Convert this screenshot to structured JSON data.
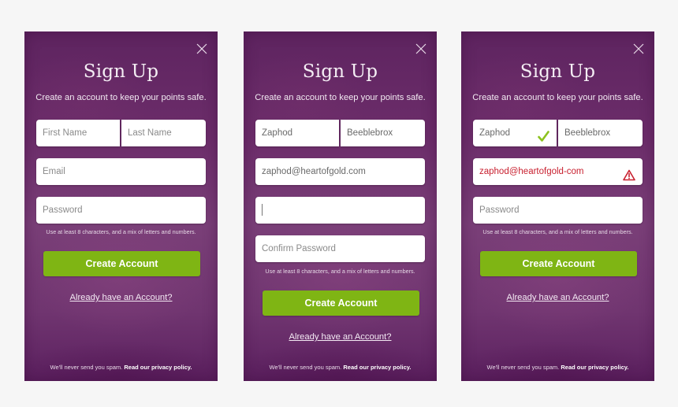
{
  "common": {
    "title": "Sign Up",
    "subtitle": "Create an account to keep your points safe.",
    "password_hint": "Use at least 8 characters, and a mix of letters and numbers.",
    "create_button": "Create Account",
    "login_link": "Already have an Account?",
    "footer_text": "We'll never send you spam.",
    "footer_link": "Read our privacy policy.",
    "icons": {
      "close": "close-icon",
      "check": "check-icon",
      "warning": "warning-icon"
    },
    "colors": {
      "panel": "#6c2d6a",
      "button": "#7fb514",
      "error": "#c8202f",
      "success": "#8cc21f",
      "page_bg": "#f6f6f6"
    }
  },
  "panels": [
    {
      "state": "empty",
      "first_name": {
        "value": "",
        "placeholder": "First Name"
      },
      "last_name": {
        "value": "",
        "placeholder": "Last Name"
      },
      "email": {
        "value": "",
        "placeholder": "Email"
      },
      "password": {
        "value": "",
        "placeholder": "Password"
      }
    },
    {
      "state": "filling",
      "first_name": {
        "value": "Zaphod",
        "placeholder": "First Name"
      },
      "last_name": {
        "value": "Beeblebrox",
        "placeholder": "Last Name"
      },
      "email": {
        "value": "zaphod@heartofgold.com",
        "placeholder": "Email"
      },
      "password": {
        "value": "",
        "placeholder": "Password"
      },
      "confirm_password": {
        "value": "",
        "placeholder": "Confirm Password"
      }
    },
    {
      "state": "validation",
      "first_name": {
        "value": "Zaphod",
        "placeholder": "First Name",
        "status": "valid"
      },
      "last_name": {
        "value": "Beeblebrox",
        "placeholder": "Last Name"
      },
      "email": {
        "value": "zaphod@heartofgold-com",
        "placeholder": "Email",
        "status": "error"
      },
      "password": {
        "value": "",
        "placeholder": "Password"
      }
    }
  ]
}
